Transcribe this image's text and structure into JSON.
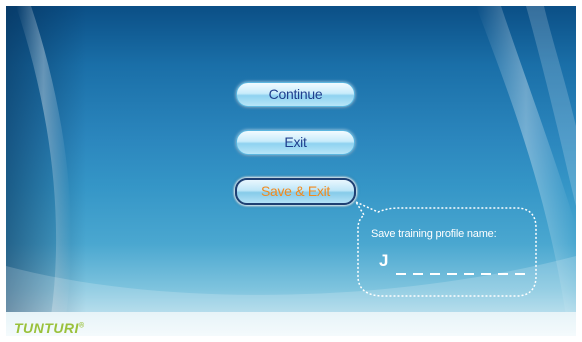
{
  "menu": {
    "continue_label": "Continue",
    "exit_label": "Exit",
    "save_exit_label": "Save & Exit",
    "selected": "Save & Exit"
  },
  "save_prompt": {
    "title": "Save training profile name:",
    "entered_text": "J",
    "slots_total": 8
  },
  "brand": {
    "logo_text": "TUNTURI",
    "logo_mark": "®"
  },
  "colors": {
    "button_text": "#1f3f8e",
    "selected_text": "#f08a1f",
    "logo": "#9ac13b",
    "bubble_outline": "#ffffff"
  }
}
